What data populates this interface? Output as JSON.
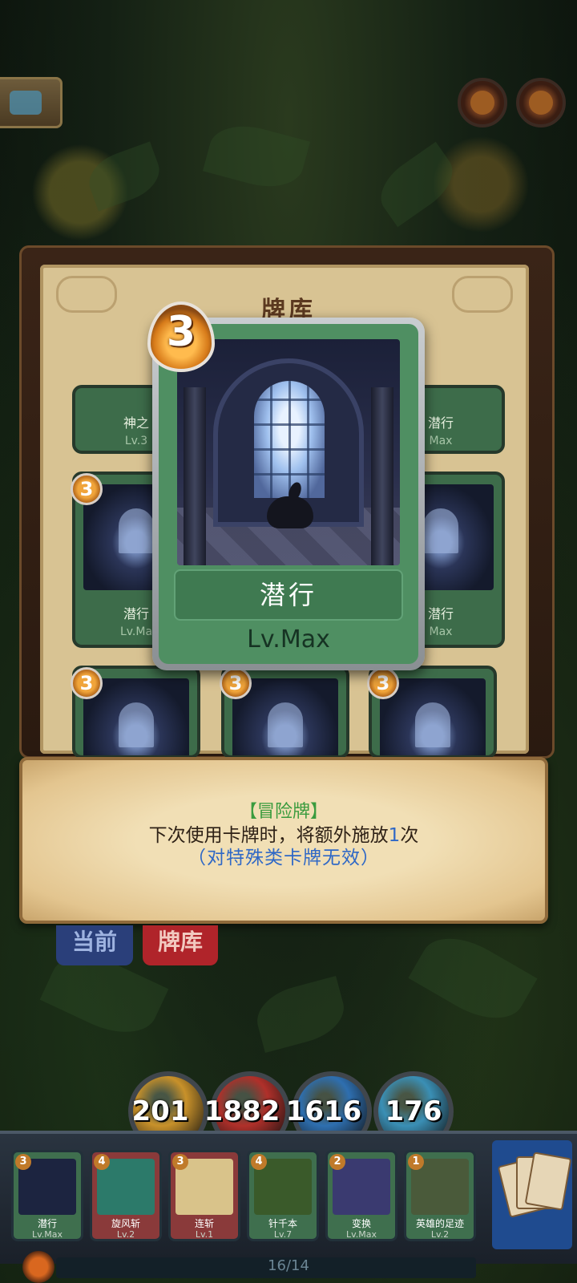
{
  "deck_panel": {
    "title": "牌库",
    "grid_cards": [
      {
        "name": "神之",
        "level": "Lv.3"
      },
      {
        "name": "潜行",
        "level": "Max"
      },
      {
        "cost": "3",
        "name": "潜行",
        "level": "Lv.Ma"
      },
      {
        "name": "潜行",
        "level": "Max"
      },
      {
        "cost": "3"
      },
      {
        "cost": "3"
      },
      {
        "cost": "3"
      }
    ]
  },
  "selected_card": {
    "cost": "3",
    "name": "潜行",
    "level": "Lv.Max"
  },
  "description": {
    "type": "【冒险牌】",
    "line_before": "下次使用卡牌时，将额外施放",
    "highlight": "1",
    "line_after": "次",
    "note": "（对特殊类卡牌无效）"
  },
  "tabs": {
    "current": "当前",
    "deck": "牌库"
  },
  "stats": [
    {
      "value": "201",
      "color": "#c8912a"
    },
    {
      "value": "1882",
      "color": "#b0302a"
    },
    {
      "value": "1616",
      "color": "#2e6fb0"
    },
    {
      "value": "176",
      "color": "#3a8fb5"
    }
  ],
  "hand": [
    {
      "cost": "3",
      "name": "潜行",
      "level": "Lv.Max",
      "bg": "#3f6f4e"
    },
    {
      "cost": "4",
      "name": "旋风斩",
      "level": "Lv.2",
      "bg": "#8a3a3a"
    },
    {
      "cost": "3",
      "name": "连斩",
      "level": "Lv.1",
      "bg": "#8a3a3a"
    },
    {
      "cost": "4",
      "name": "针千本",
      "level": "Lv.7",
      "bg": "#3f6f4e"
    },
    {
      "cost": "2",
      "name": "变换",
      "level": "Lv.Max",
      "bg": "#3f6f4e"
    },
    {
      "cost": "1",
      "name": "英雄的足迹",
      "level": "Lv.2",
      "bg": "#3f6f4e"
    }
  ],
  "deck_progress": "16/14"
}
